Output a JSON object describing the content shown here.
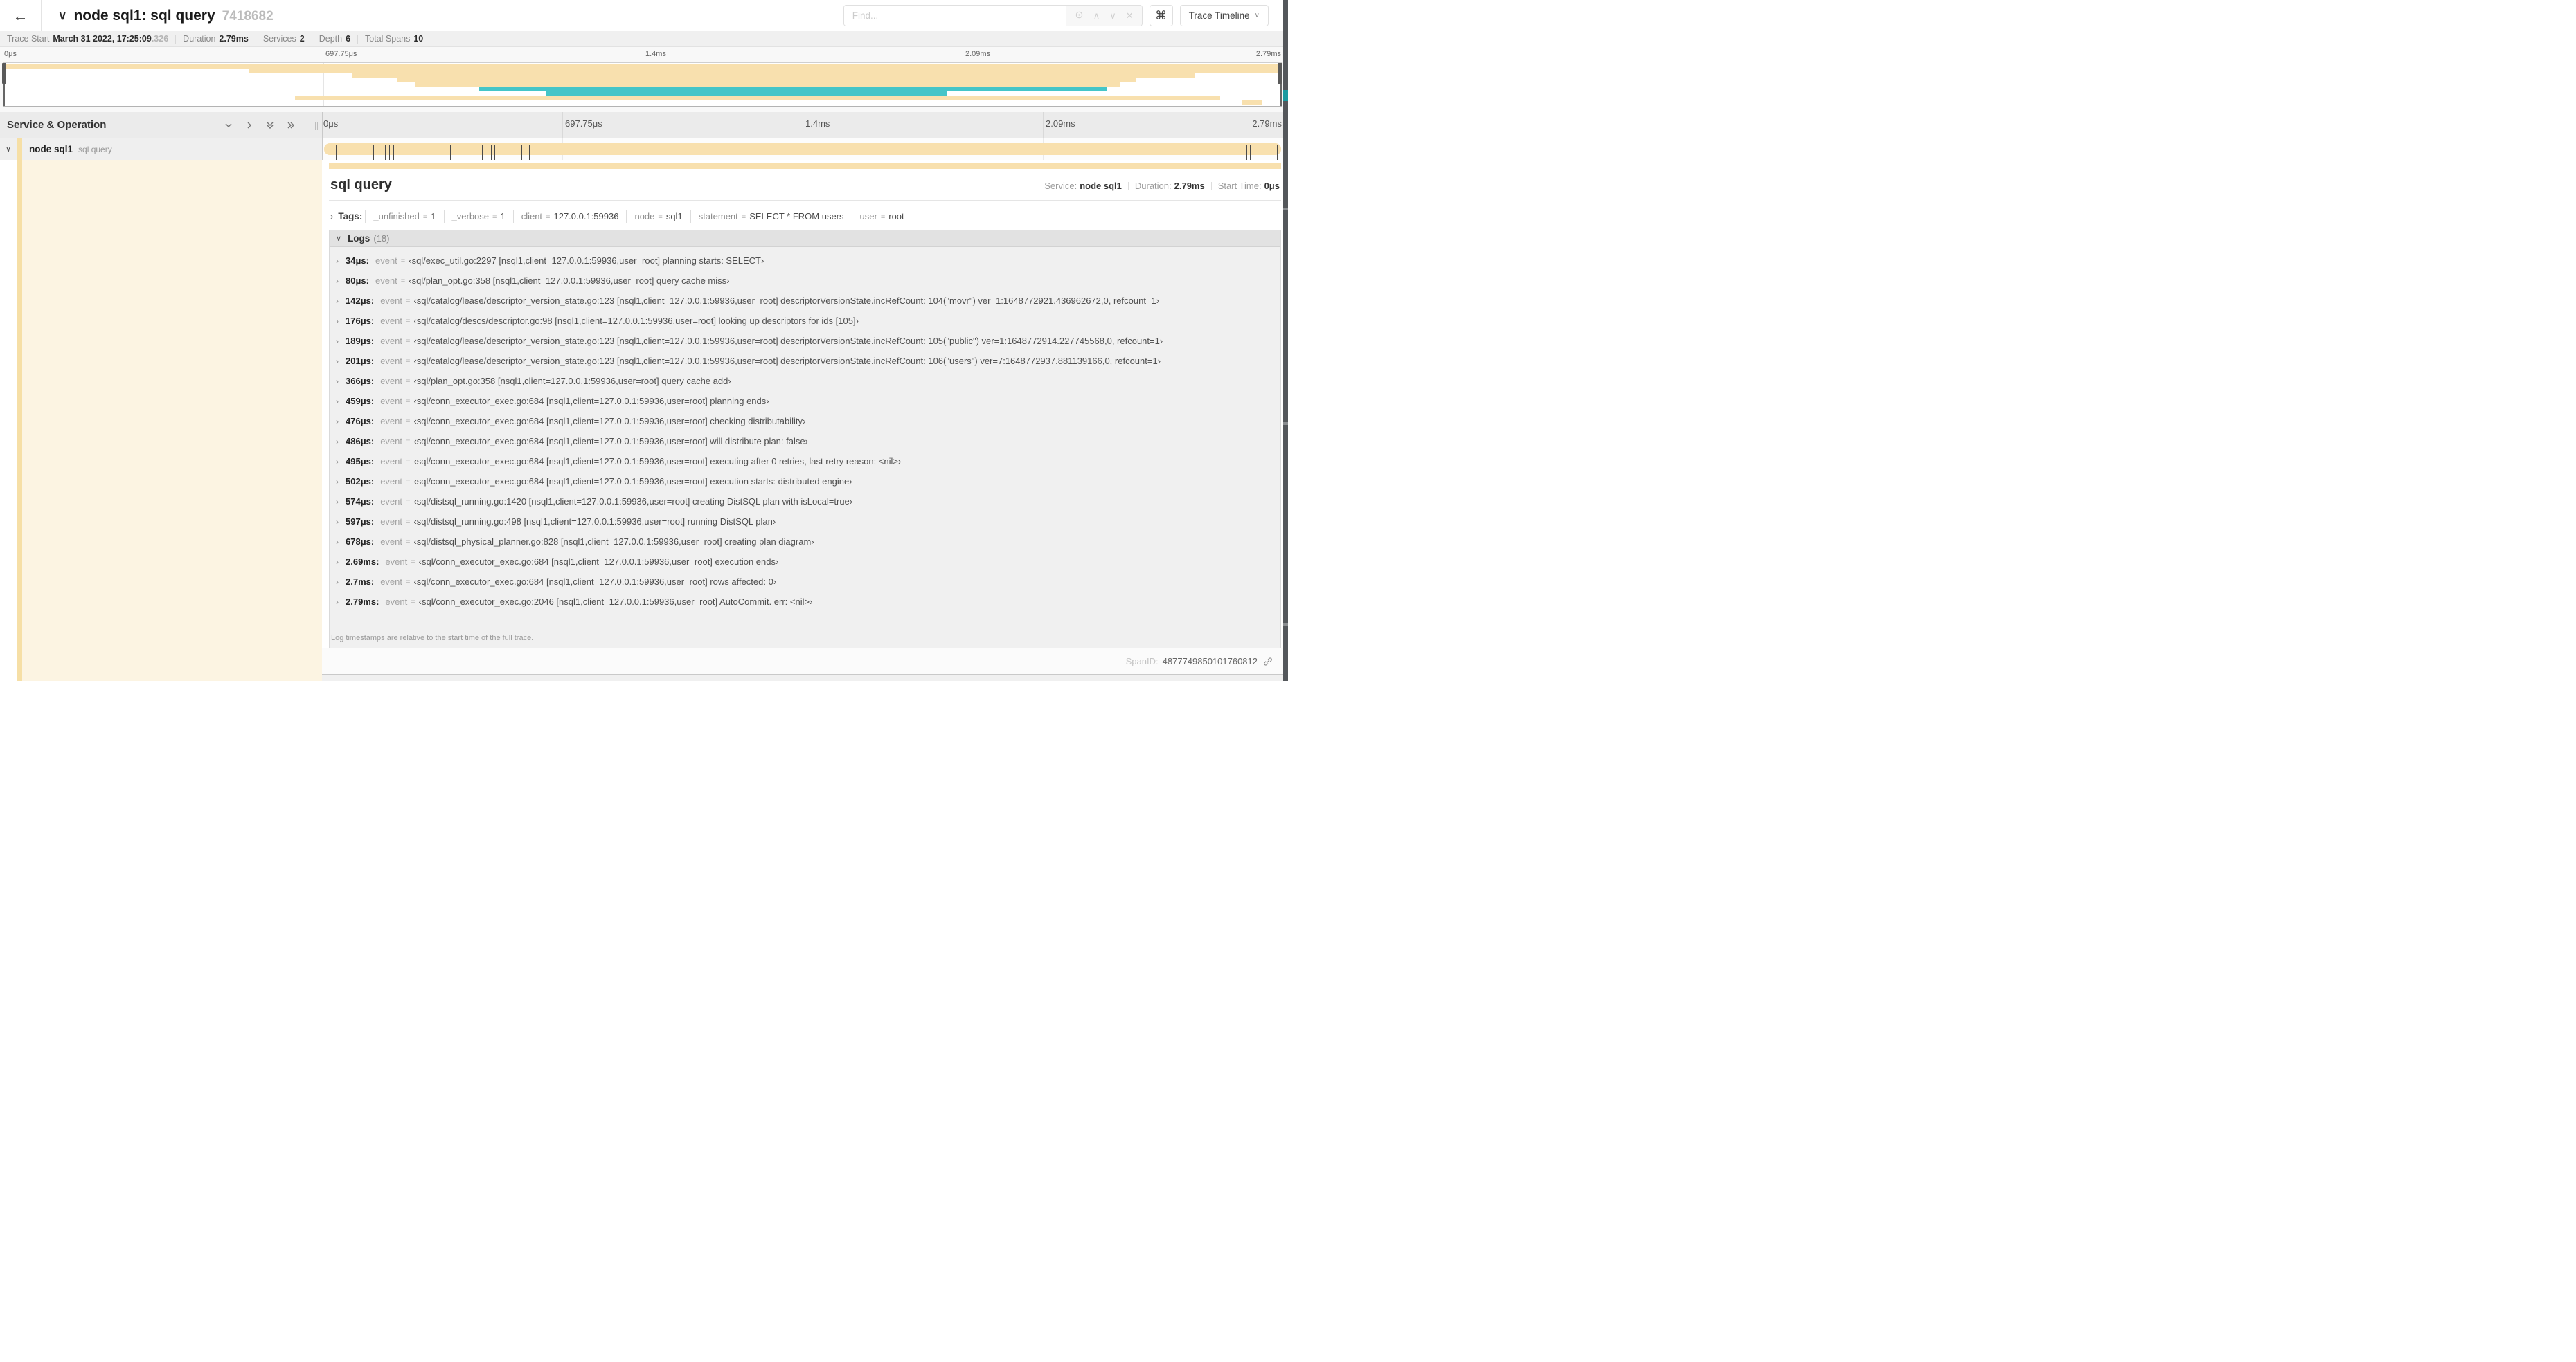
{
  "header": {
    "back": "←",
    "title_chevron": "∨",
    "title": "node sql1: sql query",
    "trace_id": "7418682",
    "find_placeholder": "Find...",
    "cmd_button": "⌘",
    "view_button": "Trace Timeline",
    "view_button_caret": "∨"
  },
  "stats": [
    {
      "label": "Trace Start",
      "value": "March 31 2022, 17:25:09",
      "suffix": ".326"
    },
    {
      "label": "Duration",
      "value": "2.79ms"
    },
    {
      "label": "Services",
      "value": "2"
    },
    {
      "label": "Depth",
      "value": "6"
    },
    {
      "label": "Total Spans",
      "value": "10"
    }
  ],
  "colors": {
    "tan": "#f8e0ae",
    "tan_soft": "#f6dfa6",
    "teal": "#45c5c8",
    "cream": "#fcf4e2"
  },
  "timeline_ticks": [
    "0μs",
    "697.75μs",
    "1.4ms",
    "2.09ms",
    "2.79ms"
  ],
  "minimap_rows": [
    {
      "start": 0,
      "end": 100,
      "color": "tan"
    },
    {
      "start": 19.2,
      "end": 100,
      "color": "tan"
    },
    {
      "start": 27.3,
      "end": 93.2,
      "color": "tan"
    },
    {
      "start": 30.8,
      "end": 88.6,
      "color": "tan"
    },
    {
      "start": 32.2,
      "end": 87.4,
      "color": "tan"
    },
    {
      "start": 37.2,
      "end": 86.3,
      "color": "teal"
    },
    {
      "start": 42.4,
      "end": 73.8,
      "color": "teal"
    },
    {
      "start": 22.8,
      "end": 95.2,
      "color": "tan"
    },
    {
      "start": 96.9,
      "end": 98.5,
      "color": "tan"
    }
  ],
  "section_header": {
    "title": "Service & Operation"
  },
  "span_row": {
    "collapse_chevron": "∨",
    "service": "node sql1",
    "operation": "sql query",
    "log_marks_pct": [
      1.22,
      2.87,
      5.09,
      6.31,
      6.77,
      7.2,
      13.12,
      16.45,
      17.06,
      17.42,
      17.74,
      18.0,
      20.57,
      21.4,
      24.3,
      96.42,
      96.77,
      99.6
    ]
  },
  "detail": {
    "title": "sql query",
    "meta": [
      {
        "label": "Service:",
        "value": "node sql1"
      },
      {
        "label": "Duration:",
        "value": "2.79ms"
      },
      {
        "label": "Start Time:",
        "value": "0μs"
      }
    ],
    "tags_caret": "›",
    "tags_label": "Tags:",
    "tags": [
      {
        "key": "_unfinished",
        "value": "1"
      },
      {
        "key": "_verbose",
        "value": "1"
      },
      {
        "key": "client",
        "value": "127.0.0.1:59936"
      },
      {
        "key": "node",
        "value": "sql1"
      },
      {
        "key": "statement",
        "value": "SELECT * FROM users"
      },
      {
        "key": "user",
        "value": "root"
      }
    ],
    "logs_caret": "∨",
    "logs_label": "Logs",
    "logs_count": "(18)",
    "logs": [
      {
        "time": "34μs:",
        "field": "event",
        "value": "‹sql/exec_util.go:2297 [nsql1,client=127.0.0.1:59936,user=root] planning starts: SELECT›"
      },
      {
        "time": "80μs:",
        "field": "event",
        "value": "‹sql/plan_opt.go:358 [nsql1,client=127.0.0.1:59936,user=root] query cache miss›"
      },
      {
        "time": "142μs:",
        "field": "event",
        "value": "‹sql/catalog/lease/descriptor_version_state.go:123 [nsql1,client=127.0.0.1:59936,user=root] descriptorVersionState.incRefCount: 104(\"movr\") ver=1:1648772921.436962672,0, refcount=1›"
      },
      {
        "time": "176μs:",
        "field": "event",
        "value": "‹sql/catalog/descs/descriptor.go:98 [nsql1,client=127.0.0.1:59936,user=root] looking up descriptors for ids [105]›"
      },
      {
        "time": "189μs:",
        "field": "event",
        "value": "‹sql/catalog/lease/descriptor_version_state.go:123 [nsql1,client=127.0.0.1:59936,user=root] descriptorVersionState.incRefCount: 105(\"public\") ver=1:1648772914.227745568,0, refcount=1›"
      },
      {
        "time": "201μs:",
        "field": "event",
        "value": "‹sql/catalog/lease/descriptor_version_state.go:123 [nsql1,client=127.0.0.1:59936,user=root] descriptorVersionState.incRefCount: 106(\"users\") ver=7:1648772937.881139166,0, refcount=1›"
      },
      {
        "time": "366μs:",
        "field": "event",
        "value": "‹sql/plan_opt.go:358 [nsql1,client=127.0.0.1:59936,user=root] query cache add›"
      },
      {
        "time": "459μs:",
        "field": "event",
        "value": "‹sql/conn_executor_exec.go:684 [nsql1,client=127.0.0.1:59936,user=root] planning ends›"
      },
      {
        "time": "476μs:",
        "field": "event",
        "value": "‹sql/conn_executor_exec.go:684 [nsql1,client=127.0.0.1:59936,user=root] checking distributability›"
      },
      {
        "time": "486μs:",
        "field": "event",
        "value": "‹sql/conn_executor_exec.go:684 [nsql1,client=127.0.0.1:59936,user=root] will distribute plan: false›"
      },
      {
        "time": "495μs:",
        "field": "event",
        "value": "‹sql/conn_executor_exec.go:684 [nsql1,client=127.0.0.1:59936,user=root] executing after 0 retries, last retry reason: <nil>›"
      },
      {
        "time": "502μs:",
        "field": "event",
        "value": "‹sql/conn_executor_exec.go:684 [nsql1,client=127.0.0.1:59936,user=root] execution starts: distributed engine›"
      },
      {
        "time": "574μs:",
        "field": "event",
        "value": "‹sql/distsql_running.go:1420 [nsql1,client=127.0.0.1:59936,user=root] creating DistSQL plan with isLocal=true›"
      },
      {
        "time": "597μs:",
        "field": "event",
        "value": "‹sql/distsql_running.go:498 [nsql1,client=127.0.0.1:59936,user=root] running DistSQL plan›"
      },
      {
        "time": "678μs:",
        "field": "event",
        "value": "‹sql/distsql_physical_planner.go:828 [nsql1,client=127.0.0.1:59936,user=root] creating plan diagram›"
      },
      {
        "time": "2.69ms:",
        "field": "event",
        "value": "‹sql/conn_executor_exec.go:684 [nsql1,client=127.0.0.1:59936,user=root] execution ends›"
      },
      {
        "time": "2.7ms:",
        "field": "event",
        "value": "‹sql/conn_executor_exec.go:684 [nsql1,client=127.0.0.1:59936,user=root] rows affected: 0›"
      },
      {
        "time": "2.79ms:",
        "field": "event",
        "value": "‹sql/conn_executor_exec.go:2046 [nsql1,client=127.0.0.1:59936,user=root] AutoCommit. err: <nil>›"
      }
    ],
    "logs_note": "Log timestamps are relative to the start time of the full trace.",
    "span_id_label": "SpanID:",
    "span_id": "4877749850101760812"
  }
}
